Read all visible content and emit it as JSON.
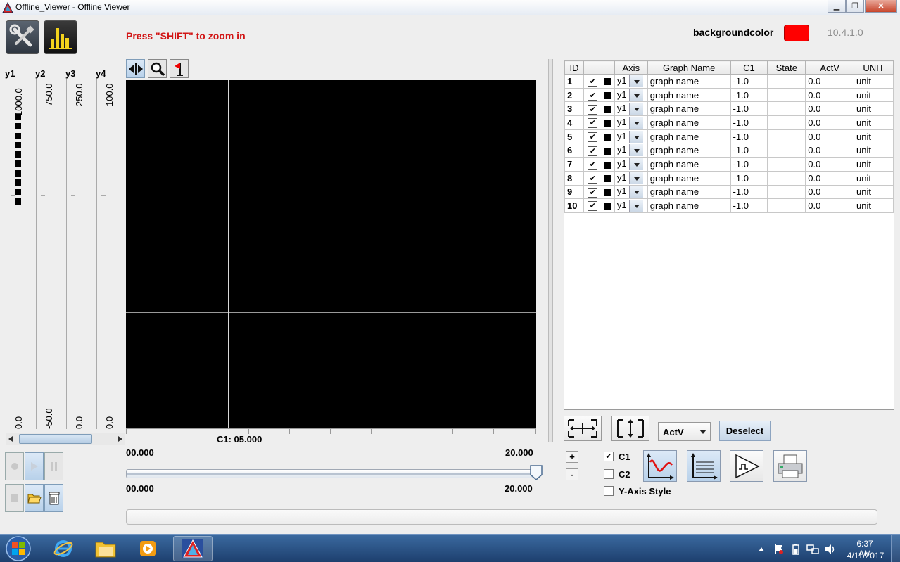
{
  "window": {
    "title": "Offline_Viewer - Offline Viewer",
    "minimize_label": "▁",
    "restore_label": "❐",
    "close_label": "✕"
  },
  "toolbar": {
    "settings_icon": "wrench-screwdriver-icon",
    "chart_icon": "bar-chart-icon",
    "zoom_hint": "Press \"SHIFT\" to zoom in",
    "background_label": "backgroundcolor",
    "background_color": "#ff0000",
    "version": "10.4.1.0"
  },
  "y_axes": [
    {
      "name": "y1",
      "max": "1000.0",
      "min": "0.0"
    },
    {
      "name": "y2",
      "max": "750.0",
      "min": "-50.0"
    },
    {
      "name": "y3",
      "max": "250.0",
      "min": "0.0"
    },
    {
      "name": "y4",
      "max": "100.0",
      "min": "0.0"
    }
  ],
  "plot": {
    "background": "#000000",
    "cursor_readout": "C1: 05.000",
    "x_start": "00.000",
    "x_end": "20.000",
    "slider_start": "00.000",
    "slider_end": "20.000"
  },
  "table": {
    "headers": [
      "ID",
      "",
      "",
      "Axis",
      "Graph Name",
      "C1",
      "State",
      "ActV",
      "UNIT"
    ],
    "rows": [
      {
        "id": "1",
        "axis": "y1",
        "name": "graph name",
        "c1": "-1.0",
        "state": "",
        "actv": "0.0",
        "unit": "unit"
      },
      {
        "id": "2",
        "axis": "y1",
        "name": "graph name",
        "c1": "-1.0",
        "state": "",
        "actv": "0.0",
        "unit": "unit"
      },
      {
        "id": "3",
        "axis": "y1",
        "name": "graph name",
        "c1": "-1.0",
        "state": "",
        "actv": "0.0",
        "unit": "unit"
      },
      {
        "id": "4",
        "axis": "y1",
        "name": "graph name",
        "c1": "-1.0",
        "state": "",
        "actv": "0.0",
        "unit": "unit"
      },
      {
        "id": "5",
        "axis": "y1",
        "name": "graph name",
        "c1": "-1.0",
        "state": "",
        "actv": "0.0",
        "unit": "unit"
      },
      {
        "id": "6",
        "axis": "y1",
        "name": "graph name",
        "c1": "-1.0",
        "state": "",
        "actv": "0.0",
        "unit": "unit"
      },
      {
        "id": "7",
        "axis": "y1",
        "name": "graph name",
        "c1": "-1.0",
        "state": "",
        "actv": "0.0",
        "unit": "unit"
      },
      {
        "id": "8",
        "axis": "y1",
        "name": "graph name",
        "c1": "-1.0",
        "state": "",
        "actv": "0.0",
        "unit": "unit"
      },
      {
        "id": "9",
        "axis": "y1",
        "name": "graph name",
        "c1": "-1.0",
        "state": "",
        "actv": "0.0",
        "unit": "unit"
      },
      {
        "id": "10",
        "axis": "y1",
        "name": "graph name",
        "c1": "-1.0",
        "state": "",
        "actv": "0.0",
        "unit": "unit"
      }
    ]
  },
  "controls": {
    "plus_label": "+",
    "minus_label": "-",
    "select_value": "ActV",
    "deselect_label": "Deselect",
    "c1_label": "C1",
    "c2_label": "C2",
    "c1_checked": true,
    "c2_checked": false,
    "y_axis_style_label": "Y-Axis Style",
    "y_axis_style_checked": false
  },
  "taskbar": {
    "time": "6:37 AM",
    "date": "4/11/2017",
    "items": [
      "internet-explorer-icon",
      "file-explorer-icon",
      "media-player-icon",
      "offline-viewer-app-icon"
    ]
  },
  "colors": {
    "accent_red": "#d11515",
    "plot_background": "#000000",
    "taskbar": "#2a5185"
  }
}
